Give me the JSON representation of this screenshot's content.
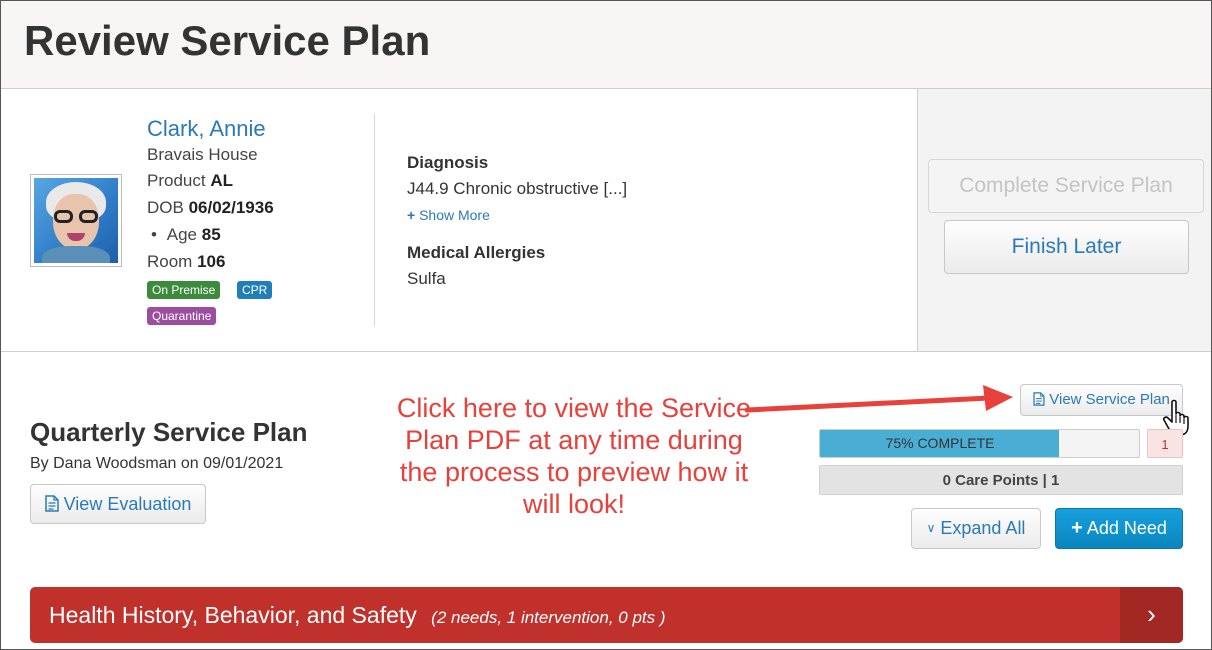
{
  "page": {
    "title": "Review Service Plan"
  },
  "resident": {
    "name": "Clark, Annie",
    "community": "Bravais House",
    "product_label": "Product",
    "product_value": "AL",
    "dob_label": "DOB",
    "dob_value": "06/02/1936",
    "age_label": "Age",
    "age_value": "85",
    "room_label": "Room",
    "room_value": "106",
    "badges": [
      {
        "label": "On Premise",
        "color": "#3c8b3d"
      },
      {
        "label": "CPR",
        "color": "#1f7fb6"
      },
      {
        "label": "Quarantine",
        "color": "#9b4d9e"
      }
    ]
  },
  "clinical": {
    "diagnosis_label": "Diagnosis",
    "diagnosis_value": "J44.9 Chronic obstructive [...]",
    "show_more": "Show More",
    "allergies_label": "Medical Allergies",
    "allergies_value": "Sulfa"
  },
  "actions": {
    "complete": "Complete Service Plan",
    "finish_later": "Finish Later"
  },
  "plan": {
    "title": "Quarterly Service Plan",
    "author_line": "By Dana Woodsman on 09/01/2021",
    "view_evaluation": "View Evaluation",
    "view_service_plan": "View Service Plan",
    "progress_label": "75% COMPLETE",
    "progress_fraction": 0.75,
    "progress_count": "1",
    "care_points": "0 Care Points | 1",
    "expand_all": "Expand All",
    "add_need": "Add Need"
  },
  "callout": {
    "text": "Click here to view the Service Plan PDF at any time during the process to preview how it will look!"
  },
  "needs": [
    {
      "title": "Health History, Behavior, and Safety",
      "summary": "(2 needs, 1 intervention, 0 pts )"
    }
  ],
  "colors": {
    "accent": "#2a7ab7",
    "callout": "#e8403b",
    "need_bar": "#c1312c",
    "primary_button": "#0a86c0",
    "progress": "#4aaed4"
  }
}
